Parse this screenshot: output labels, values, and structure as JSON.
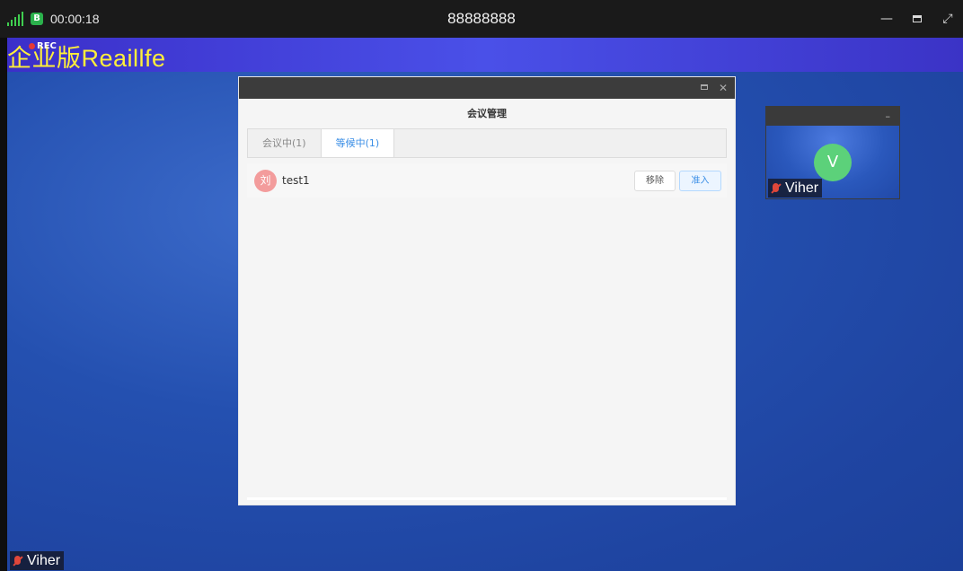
{
  "titlebar": {
    "timer": "00:00:18",
    "lock_badge": "B",
    "meeting_id": "88888888",
    "minimize_glyph": "—",
    "fullscreen_glyph": "⤢"
  },
  "logo": {
    "text": "企业版Reaillfe",
    "rec_label": "REC"
  },
  "dialog": {
    "title": "会议管理",
    "close_glyph": "✕",
    "tabs": [
      {
        "label": "会议中(1)",
        "active": false
      },
      {
        "label": "等候中(1)",
        "active": true
      }
    ],
    "rows": [
      {
        "avatar_text": "刘",
        "name": "test1",
        "remove_label": "移除",
        "admit_label": "准入"
      }
    ]
  },
  "thumbnail": {
    "minimize_glyph": "–",
    "avatar_letter": "V",
    "name": "Viher"
  },
  "main_video": {
    "name": "Viher"
  },
  "colors": {
    "accent": "#3a8ee6",
    "logo_yellow": "#ffef3a",
    "signal_green": "#3fce4f",
    "avatar_green": "#5cd17a",
    "avatar_pink": "#f39c9c"
  }
}
